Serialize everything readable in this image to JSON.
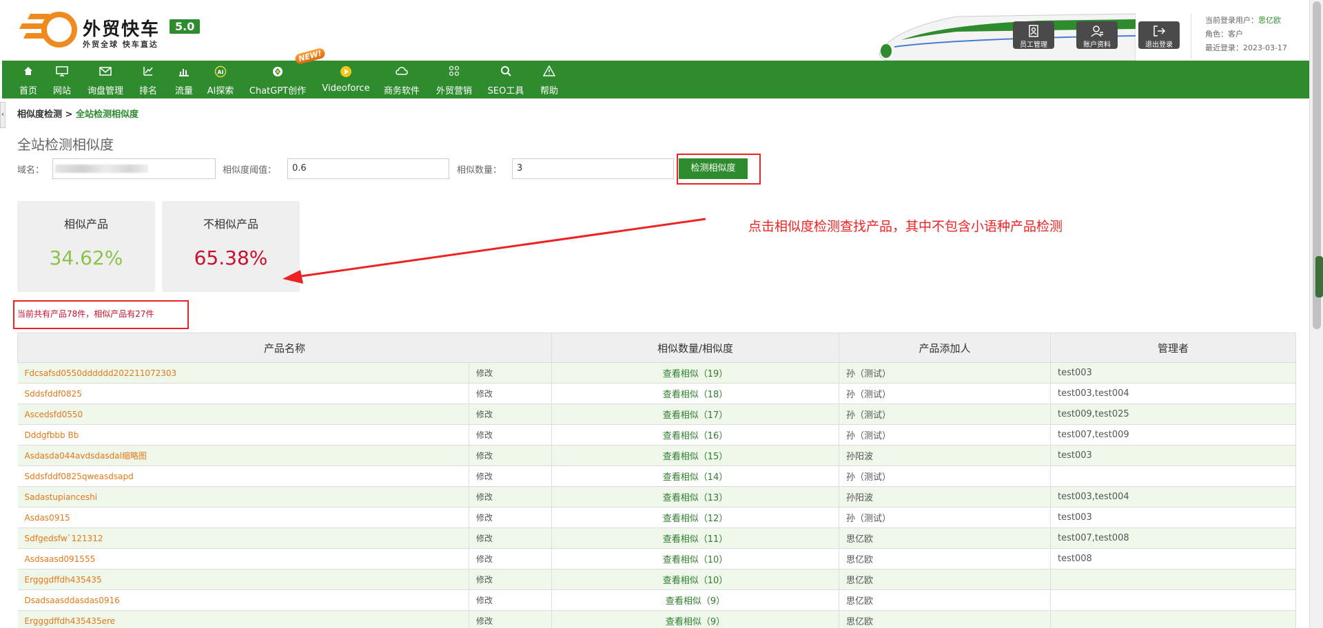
{
  "brand": {
    "title": "外贸快车",
    "version": "5.0",
    "slogan": "外贸全球 快车直达"
  },
  "header_buttons": [
    {
      "label": "员工管理",
      "icon": "staff-icon"
    },
    {
      "label": "账户资料",
      "icon": "account-icon"
    },
    {
      "label": "退出登录",
      "icon": "logout-icon"
    }
  ],
  "user": {
    "current_label": "当前登录用户：",
    "current_value": "思亿欧",
    "role_label": "角色：",
    "role_value": "客户",
    "last_label": "最近登录：",
    "last_value": "2023-03-17"
  },
  "nav": [
    {
      "label": "首页",
      "icon": "home-icon"
    },
    {
      "label": "网站",
      "icon": "monitor-icon"
    },
    {
      "label": "询盘管理",
      "icon": "mail-icon"
    },
    {
      "label": "排名",
      "icon": "rank-icon"
    },
    {
      "label": "流量",
      "icon": "bar-chart-icon"
    },
    {
      "label": "AI探索",
      "icon": "ai-icon"
    },
    {
      "label": "ChatGPT创作",
      "icon": "chatgpt-icon"
    },
    {
      "label": "Videoforce",
      "icon": "video-icon"
    },
    {
      "label": "商务软件",
      "icon": "cloud-icon"
    },
    {
      "label": "外贸营销",
      "icon": "grid-icon"
    },
    {
      "label": "SEO工具",
      "icon": "search-icon"
    },
    {
      "label": "帮助",
      "icon": "warning-icon"
    }
  ],
  "new_badge": "NEW!",
  "breadcrumb": {
    "parent": "相似度检测",
    "sep": " > ",
    "current": "全站检测相似度"
  },
  "page_title": "全站检测相似度",
  "form": {
    "domain_label": "域名：",
    "threshold_label": "相似度阈值：",
    "threshold_value": "0.6",
    "count_label": "相似数量：",
    "count_value": "3",
    "detect_button": "检测相似度"
  },
  "stats": {
    "similar_label": "相似产品",
    "similar_value": "34.62%",
    "dissimilar_label": "不相似产品",
    "dissimilar_value": "65.38%"
  },
  "annotation": "点击相似度检测查找产品，其中不包含小语种产品检测",
  "summary": "当前共有产品78件，相似产品有27件",
  "table": {
    "headers": [
      "产品名称",
      "相似数量/相似度",
      "产品添加人",
      "管理者"
    ],
    "edit_label": "修改",
    "rows": [
      {
        "name": "Fdcsafsd0550dddddd202211072303",
        "sim": "查看相似（19）",
        "adder": "孙（测试）",
        "mgr": "test003"
      },
      {
        "name": "Sddsfddf0825",
        "sim": "查看相似（18）",
        "adder": "孙（测试）",
        "mgr": "test003,test004"
      },
      {
        "name": "Ascedsfd0550",
        "sim": "查看相似（17）",
        "adder": "孙（测试）",
        "mgr": "test009,test025"
      },
      {
        "name": "Dddgfbbb Bb",
        "sim": "查看相似（16）",
        "adder": "孙（测试）",
        "mgr": "test007,test009"
      },
      {
        "name": "Asdasda044avdsdasdal缩略图",
        "sim": "查看相似（15）",
        "adder": "孙阳波",
        "mgr": "test003"
      },
      {
        "name": "Sddsfddf0825qweasdsapd",
        "sim": "查看相似（14）",
        "adder": "孙（测试）",
        "mgr": ""
      },
      {
        "name": "Sadastupianceshi",
        "sim": "查看相似（13）",
        "adder": "孙阳波",
        "mgr": "test003,test004"
      },
      {
        "name": "Asdas0915",
        "sim": "查看相似（12）",
        "adder": "孙（测试）",
        "mgr": "test003"
      },
      {
        "name": "Sdfgedsfw`121312",
        "sim": "查看相似（11）",
        "adder": "思亿欧",
        "mgr": "test007,test008"
      },
      {
        "name": "Asdsaasd091555",
        "sim": "查看相似（10）",
        "adder": "思亿欧",
        "mgr": "test008"
      },
      {
        "name": "Ergggdffdh435435",
        "sim": "查看相似（10）",
        "adder": "思亿欧",
        "mgr": ""
      },
      {
        "name": "Dsadsaasddasdas0916",
        "sim": "查看相似（9）",
        "adder": "思亿欧",
        "mgr": ""
      },
      {
        "name": "Ergggdffdh435435ere",
        "sim": "查看相似（9）",
        "adder": "思亿欧",
        "mgr": ""
      }
    ]
  },
  "colors": {
    "primary_green": "#2e8b2e",
    "accent_orange": "#e67817",
    "alert_red": "#e22"
  }
}
